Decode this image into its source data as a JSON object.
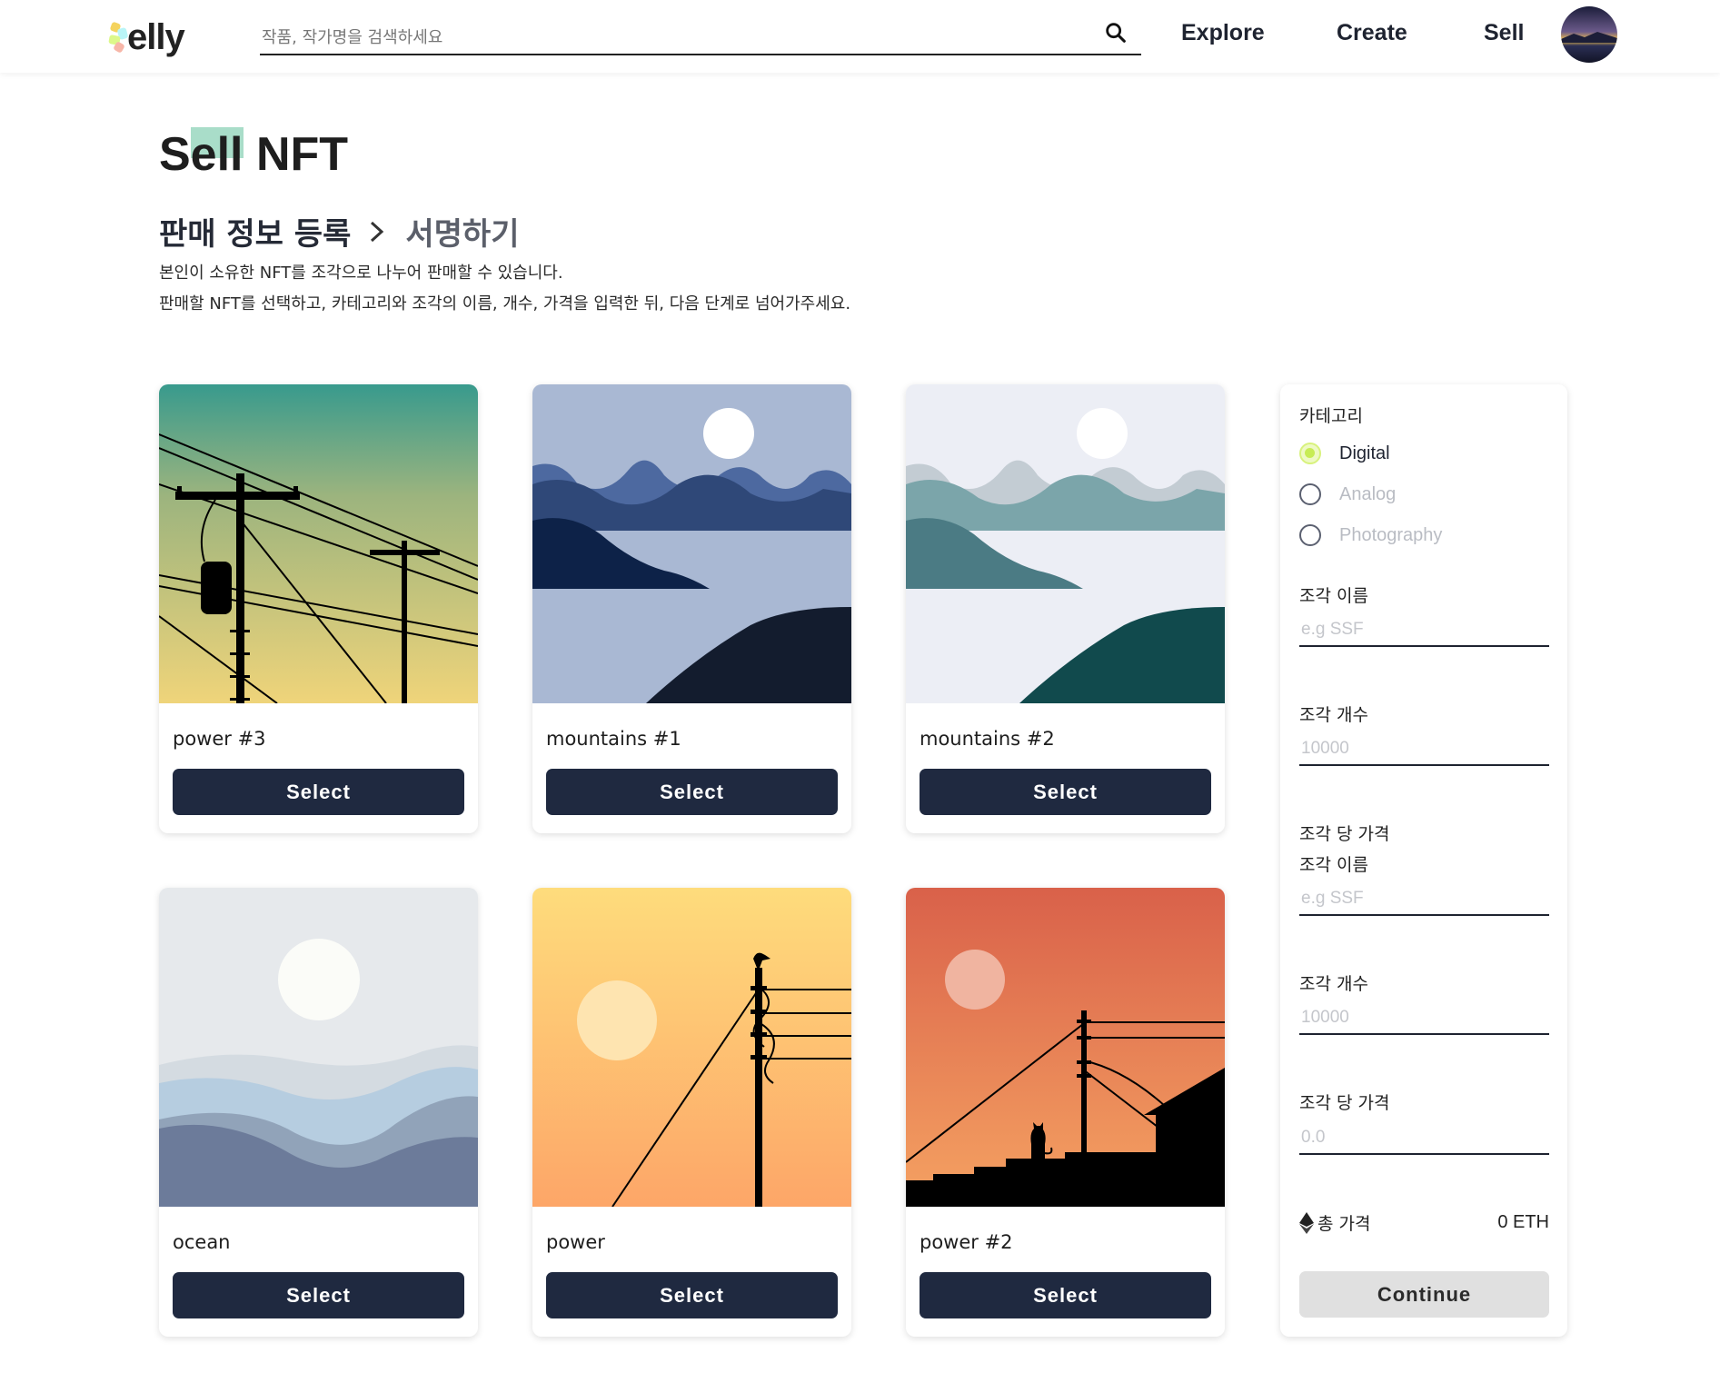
{
  "header": {
    "logo_text": "elly",
    "search_placeholder": "작품, 작가명을 검색하세요",
    "nav": [
      {
        "label": "Explore",
        "highlight": "#b9f5f7"
      },
      {
        "label": "Create",
        "highlight": "#dcf88a"
      },
      {
        "label": "Sell",
        "highlight": "#a9ddc9"
      }
    ]
  },
  "page": {
    "title": "Sell NFT",
    "step1": "판매 정보 등록",
    "step2": "서명하기",
    "desc_line1": "본인이 소유한 NFT를 조각으로 나누어 판매할 수 있습니다.",
    "desc_line2": "판매할 NFT를 선택하고, 카테고리와 조각의 이름, 개수, 가격을 입력한 뒤, 다음 단계로 넘어가주세요."
  },
  "cards": [
    {
      "name": "power #3",
      "button": "Select",
      "art": "power-lines-teal-yellow"
    },
    {
      "name": "mountains #1",
      "button": "Select",
      "art": "mountains-blue"
    },
    {
      "name": "mountains #2",
      "button": "Select",
      "art": "mountains-teal"
    },
    {
      "name": "ocean",
      "button": "Select",
      "art": "ocean-waves"
    },
    {
      "name": "power",
      "button": "Select",
      "art": "power-lines-sunset-yellow"
    },
    {
      "name": "power #2",
      "button": "Select",
      "art": "power-lines-cat-orange"
    }
  ],
  "panel": {
    "category_label": "카테고리",
    "categories": [
      {
        "label": "Digital",
        "selected": true
      },
      {
        "label": "Analog",
        "selected": false
      },
      {
        "label": "Photography",
        "selected": false
      }
    ],
    "piece_name_label": "조각 이름",
    "piece_name_placeholder": "e.g SSF",
    "piece_count_label": "조각 개수",
    "piece_count_placeholder": "10000",
    "price_label_1": "조각 당 가격",
    "piece_name_label_2": "조각 이름",
    "piece_name_placeholder_2": "e.g SSF",
    "piece_count_label_2": "조각 개수",
    "piece_count_placeholder_2": "10000",
    "price_label_2": "조각 당 가격",
    "price_placeholder": "0.0",
    "total_label": "총 가격",
    "total_value": "0 ETH",
    "continue_label": "Continue"
  },
  "colors": {
    "button_dark": "#1f2940",
    "radio_selected": "#c7ec55",
    "continue_bg": "#e0e0e0"
  }
}
